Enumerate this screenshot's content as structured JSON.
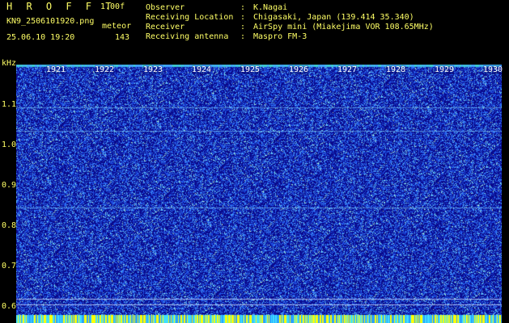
{
  "header": {
    "app_title": "H R O F F T",
    "version": "1.00f",
    "filename": "KN9_2506101920.png",
    "meteor_label": "meteor",
    "datetime": "25.06.10 19:20",
    "meteor_count": "143"
  },
  "meta": [
    {
      "key": "Observer",
      "value": "K.Nagai"
    },
    {
      "key": "Receiving Location",
      "value": "Chigasaki, Japan (139.414 35.340)"
    },
    {
      "key": "Receiver",
      "value": "AirSpy mini (Miakejima VOR 108.65MHz)"
    },
    {
      "key": "Receiving antenna",
      "value": "Maspro FM-3"
    }
  ],
  "axes": {
    "y_unit": "kHz",
    "y_ticks": [
      "1.1",
      "1.0",
      "0.9",
      "0.8",
      "0.7",
      "0.6"
    ],
    "x_ticks": [
      "1921",
      "1922",
      "1923",
      "1924",
      "1925",
      "1926",
      "1927",
      "1928",
      "1929",
      "1930"
    ]
  },
  "colors": {
    "background": "#000000",
    "text": "#ffff66",
    "spectrogram_base": "#0a0a8c",
    "noise": "#2a6cff",
    "carrier": "#7fd0ff",
    "bottom_band": "#ffff00"
  }
}
